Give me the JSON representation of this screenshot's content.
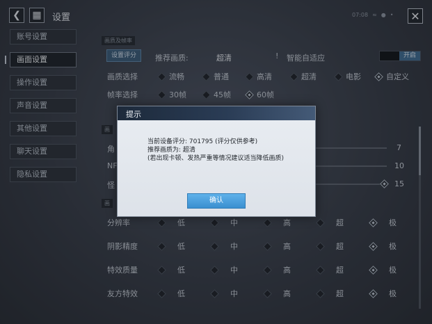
{
  "topbar": {
    "title": "设置",
    "status_time": "07:08",
    "back_icon": "back-arrow-icon",
    "grid_icon": "grid-menu-icon",
    "close_icon": "close-icon"
  },
  "sidebar": {
    "items": [
      {
        "label": "账号设置",
        "active": false
      },
      {
        "label": "画面设置",
        "active": true
      },
      {
        "label": "操作设置",
        "active": false
      },
      {
        "label": "声音设置",
        "active": false
      },
      {
        "label": "其他设置",
        "active": false
      },
      {
        "label": "聊天设置",
        "active": false
      },
      {
        "label": "隐私设置",
        "active": false
      }
    ]
  },
  "main": {
    "section1_header": "画质及帧率",
    "score_button": "设置评分",
    "recommend_label": "推荐画质:",
    "recommend_value": "超清",
    "adaptive_label": "智能自适应",
    "adaptive_toggle": "开启",
    "quality_row": {
      "label": "画质选择",
      "options": [
        "流畅",
        "普通",
        "高清",
        "超清",
        "电影",
        "自定义"
      ],
      "selected_index": 5
    },
    "fps_row": {
      "label": "帧率选择",
      "options": [
        "30帧",
        "45帧",
        "60帧"
      ],
      "selected_index": 2
    },
    "section2_header": "画",
    "slider_rows": [
      {
        "label": "角",
        "value": "7"
      },
      {
        "label": "NF",
        "value": "10"
      },
      {
        "label": "怪",
        "value": "15"
      }
    ],
    "section3_header": "画",
    "grade_rows": [
      {
        "label": "分辨率",
        "options": [
          "低",
          "中",
          "高",
          "超",
          "极"
        ],
        "selected_index": 4
      },
      {
        "label": "阴影精度",
        "options": [
          "低",
          "中",
          "高",
          "超",
          "极"
        ],
        "selected_index": 4
      },
      {
        "label": "特效质量",
        "options": [
          "低",
          "中",
          "高",
          "超",
          "极"
        ],
        "selected_index": 4
      },
      {
        "label": "友方特效",
        "options": [
          "低",
          "中",
          "高",
          "超",
          "极"
        ],
        "selected_index": 4
      }
    ]
  },
  "modal": {
    "title": "提示",
    "line1": "当前设备评分: 701795 (评分仅供参考)",
    "line2": "推荐画质为: 超清",
    "line3": "(若出现卡顿、发热严重等情况建议适当降低画质)",
    "confirm": "确认"
  },
  "colors": {
    "accent": "#3a8fd0",
    "modal_header": "#1d2a3b",
    "background": "#2b3038"
  }
}
